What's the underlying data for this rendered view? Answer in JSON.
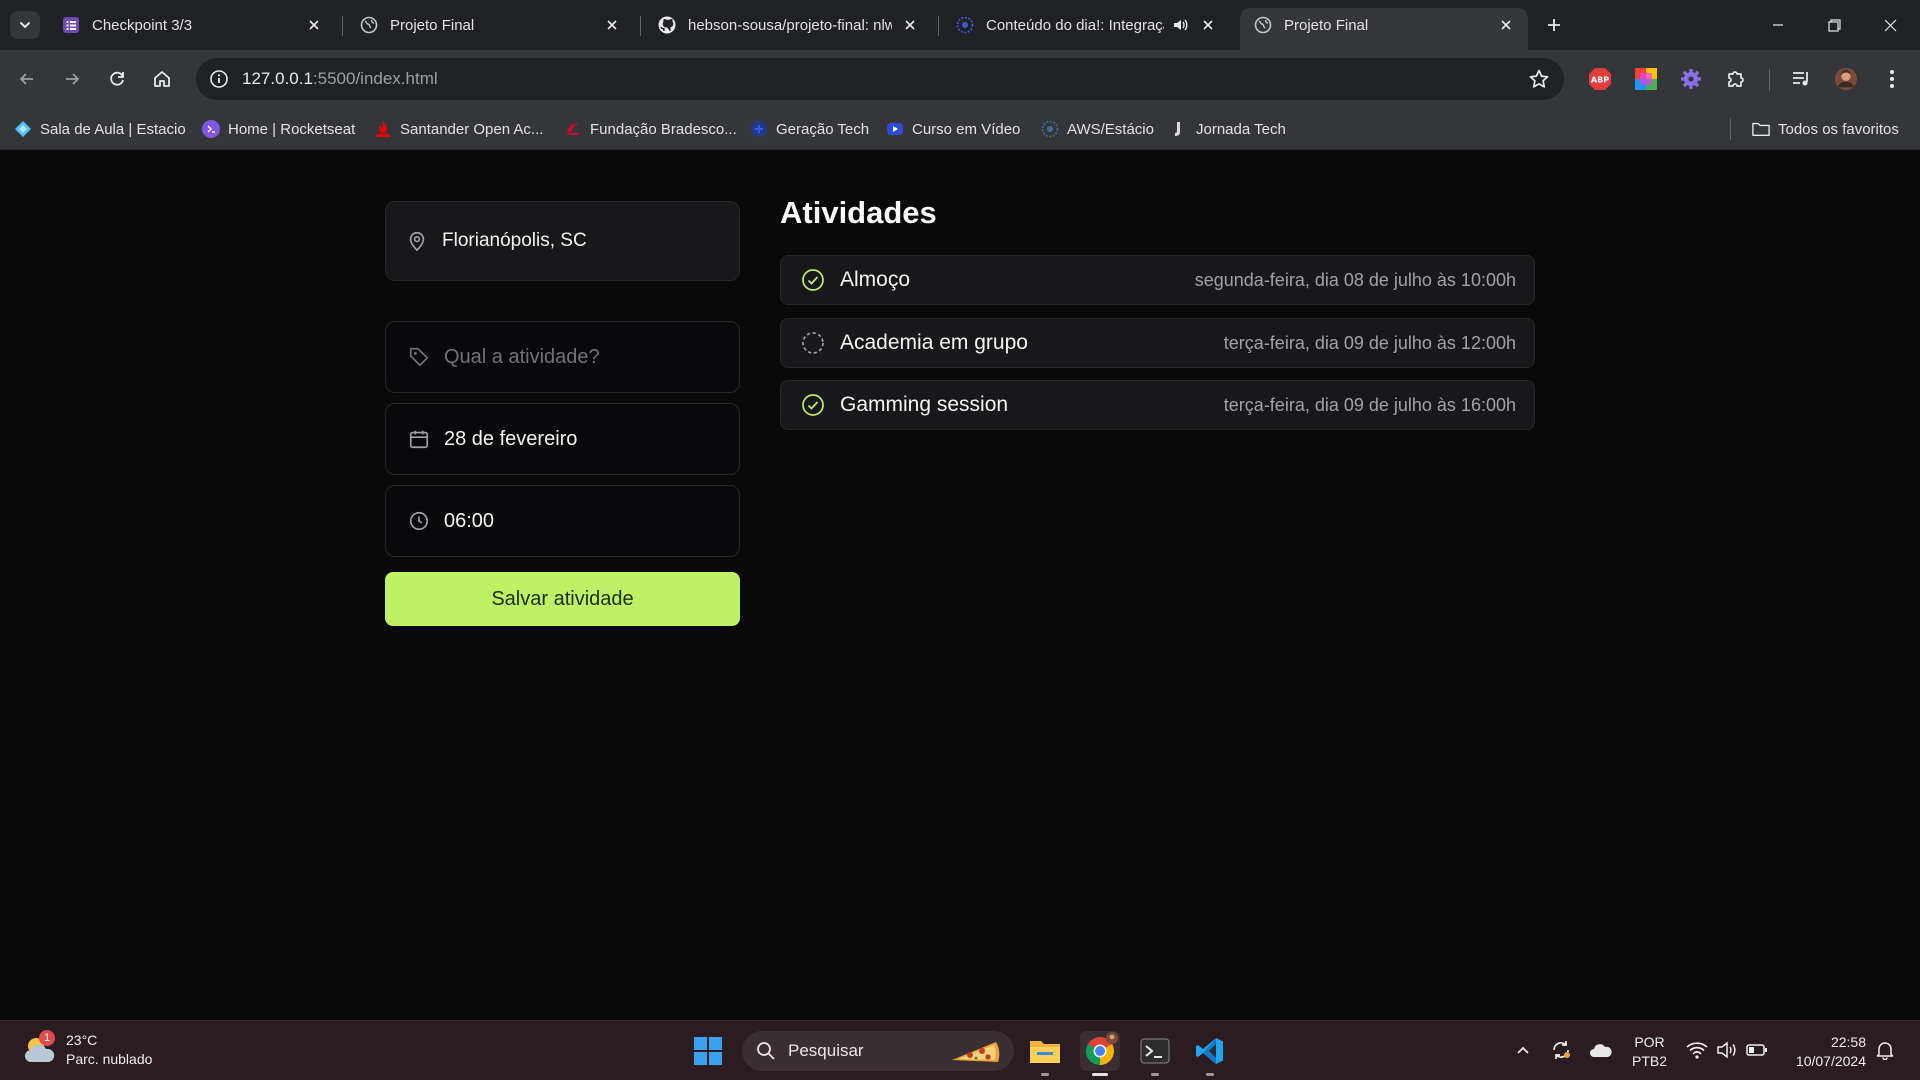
{
  "browser": {
    "tabs": [
      {
        "title": "Checkpoint 3/3",
        "icon": "form-icon"
      },
      {
        "title": "Projeto Final",
        "icon": "globe-icon"
      },
      {
        "title": "hebson-sousa/projeto-final: nlw",
        "icon": "github-icon"
      },
      {
        "title": "Conteúdo do dia!: Integração",
        "icon": "course-icon"
      },
      {
        "title": "Projeto Final",
        "icon": "globe-icon",
        "active": true
      }
    ],
    "url_host": "127.0.0.1",
    "url_rest": ":5500/index.html"
  },
  "bookmarks": {
    "items": [
      {
        "label": "Sala de Aula | Estacio",
        "color": "#4fc3f7"
      },
      {
        "label": "Home | Rocketseat",
        "color": "#8257e5"
      },
      {
        "label": "Santander Open Ac...",
        "color": "#ec0000"
      },
      {
        "label": "Fundação Bradesco...",
        "color": "#cc092f"
      },
      {
        "label": "Geração Tech",
        "color": "#1e3a8a"
      },
      {
        "label": "Curso em Vídeo",
        "color": "#2d4bd8"
      },
      {
        "label": "AWS/Estácio",
        "color": "#1e4d7a"
      },
      {
        "label": "Jornada Tech",
        "color": "#dddddd"
      }
    ],
    "all_favorites": "Todos os favoritos"
  },
  "app": {
    "location": "Florianópolis, SC",
    "activity_placeholder": "Qual a atividade?",
    "date_value": "28 de fevereiro",
    "time_value": "06:00",
    "save_label": "Salvar atividade",
    "accent": "#bef264",
    "activities_title": "Atividades",
    "activities": [
      {
        "name": "Almoço",
        "date": "segunda-feira, dia 08 de julho às 10:00h",
        "done": true
      },
      {
        "name": "Academia em grupo",
        "date": "terça-feira, dia 09 de julho às 12:00h",
        "done": false
      },
      {
        "name": "Gamming session",
        "date": "terça-feira, dia 09 de julho às 16:00h",
        "done": true
      }
    ]
  },
  "taskbar": {
    "weather_temp": "23°C",
    "weather_desc": "Parc. nublado",
    "weather_badge": "1",
    "search_label": "Pesquisar",
    "lang_1": "POR",
    "lang_2": "PTB2",
    "time": "22:58",
    "date": "10/07/2024"
  }
}
